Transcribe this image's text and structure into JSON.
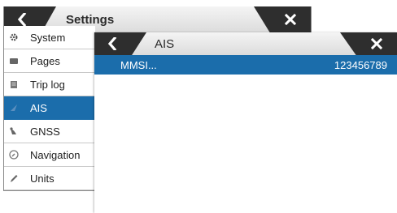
{
  "settings": {
    "title": "Settings",
    "items": [
      {
        "label": "System"
      },
      {
        "label": "Pages"
      },
      {
        "label": "Trip log"
      },
      {
        "label": "AIS"
      },
      {
        "label": "GNSS"
      },
      {
        "label": "Navigation"
      },
      {
        "label": "Units"
      }
    ],
    "selected_item": "AIS"
  },
  "ais": {
    "title": "AIS",
    "rows": [
      {
        "label": "MMSI...",
        "value": "123456789"
      }
    ]
  },
  "colors": {
    "selection": "#1b6dab",
    "titlebar_dark": "#2e2e2e",
    "titlebar_light": "#e6e6e6"
  },
  "icons": {
    "back": "chevron-left-icon",
    "close": "close-icon",
    "menu": [
      "gear-icon",
      "pages-icon",
      "trip-log-icon",
      "ais-icon",
      "satellite-icon",
      "compass-icon",
      "pencil-icon"
    ]
  }
}
